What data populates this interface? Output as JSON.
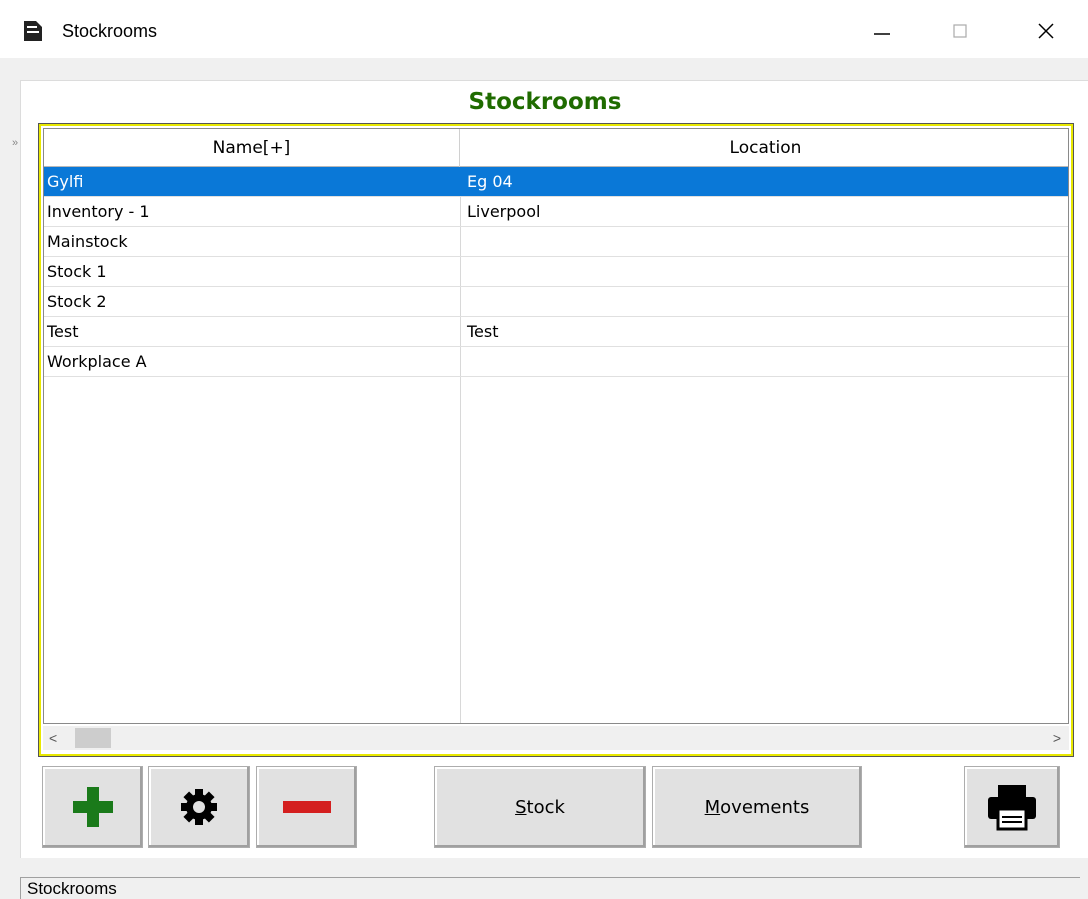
{
  "window": {
    "title": "Stockrooms",
    "controls": {
      "minimize": "—",
      "maximize": "☐",
      "close": "✕"
    }
  },
  "panel": {
    "title": "Stockrooms",
    "side_indicator": "»"
  },
  "grid": {
    "columns": [
      "Name[+]",
      "Location"
    ],
    "rows": [
      {
        "name": "Gylfi",
        "location": "Eg 04",
        "selected": true
      },
      {
        "name": "Inventory - 1",
        "location": "Liverpool",
        "selected": false
      },
      {
        "name": "Mainstock",
        "location": "",
        "selected": false
      },
      {
        "name": "Stock 1",
        "location": "",
        "selected": false
      },
      {
        "name": "Stock 2",
        "location": "",
        "selected": false
      },
      {
        "name": "Test",
        "location": "Test",
        "selected": false
      },
      {
        "name": "Workplace A",
        "location": "",
        "selected": false
      }
    ],
    "scroll_left": "<",
    "scroll_right": ">"
  },
  "toolbar": {
    "add_icon": "plus-icon",
    "settings_icon": "gear-icon",
    "remove_icon": "minus-icon",
    "stock_label_accel": "S",
    "stock_label_rest": "tock",
    "movements_label_accel": "M",
    "movements_label_rest": "ovements",
    "print_icon": "printer-icon"
  },
  "status": {
    "text": "Stockrooms"
  },
  "colors": {
    "title_green": "#1f6b00",
    "selection_blue": "#0a78d7",
    "grid_border_yellow": "#e8e800",
    "add_green": "#1a7a1a",
    "remove_red": "#d41f1f"
  }
}
